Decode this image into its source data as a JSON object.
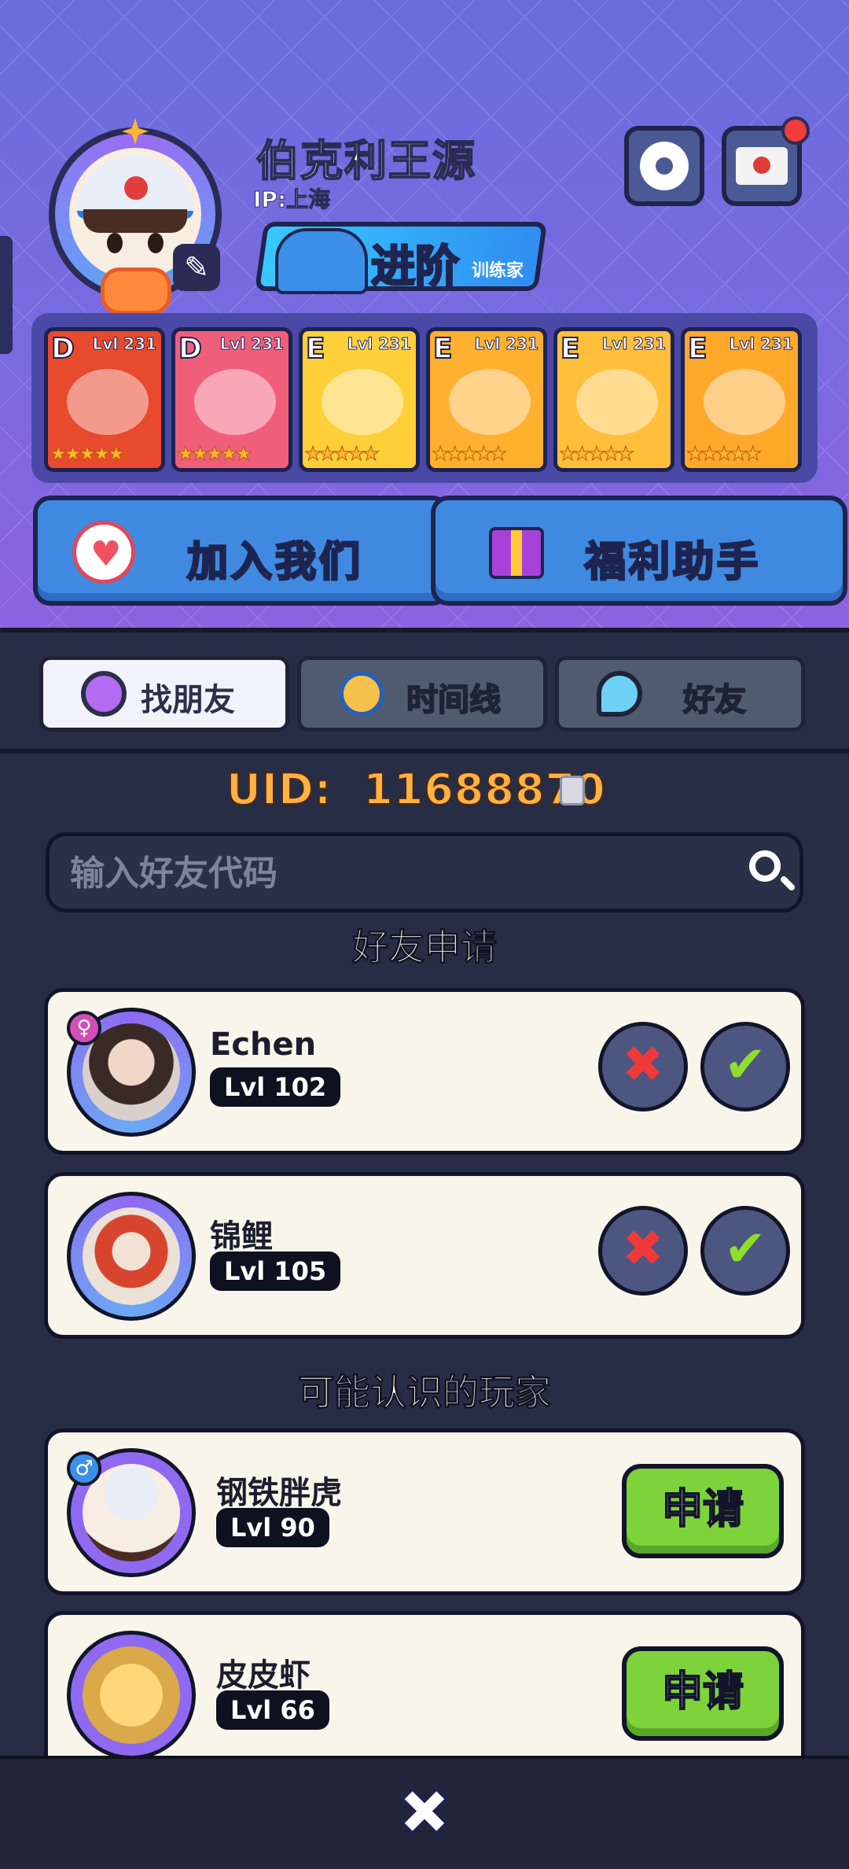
{
  "profile": {
    "name": "伯克利王源",
    "ip": "IP:上海",
    "promote_label": "进阶",
    "promote_sub": "训练家"
  },
  "top_buttons": {
    "settings_icon": "gear-icon",
    "mail_icon": "mail-icon"
  },
  "cards": [
    {
      "grade": "D",
      "level": "Lvl 231",
      "stars": "★★★★★",
      "color": "#e84a2e"
    },
    {
      "grade": "D",
      "level": "Lvl 231",
      "stars": "★★★★★",
      "color": "#f05f7a"
    },
    {
      "grade": "E",
      "level": "Lvl 231",
      "stars": "★★★★★",
      "color": "#ffcf3a"
    },
    {
      "grade": "E",
      "level": "Lvl 231",
      "stars": "★★★★★",
      "color": "#ffb02e"
    },
    {
      "grade": "E",
      "level": "Lvl 231",
      "stars": "★★★★★",
      "color": "#ffbf3a"
    },
    {
      "grade": "E",
      "level": "Lvl 231",
      "stars": "★★★★★",
      "color": "#ffa82a"
    }
  ],
  "actions": {
    "join_label": "加入我们",
    "welfare_label": "福利助手"
  },
  "tabs": [
    {
      "label": "找朋友",
      "icon": "search-icon",
      "active": true
    },
    {
      "label": "时间线",
      "icon": "clock-icon",
      "active": false
    },
    {
      "label": "好友",
      "icon": "friends-icon",
      "active": false
    }
  ],
  "uid": {
    "label": "UID:",
    "value": "11688870"
  },
  "search": {
    "placeholder": "输入好友代码",
    "value": ""
  },
  "requests": {
    "title": "好友申请",
    "items": [
      {
        "name": "Echen",
        "level": "Lvl 102",
        "gender": "♀"
      },
      {
        "name": "锦鲤",
        "level": "Lvl 105",
        "gender": ""
      }
    ]
  },
  "suggestions": {
    "title": "可能认识的玩家",
    "items": [
      {
        "name": "钢铁胖虎",
        "level": "Lvl 90",
        "gender": "♂",
        "button": "申请"
      },
      {
        "name": "皮皮虾",
        "level": "Lvl 66",
        "gender": "",
        "button": "申请"
      }
    ]
  },
  "footer": {
    "close_icon": "close-icon",
    "close_glyph": "✖"
  },
  "colors": {
    "header": "#7a6ae0",
    "accent_uid": "#ffb143",
    "apply_green": "#7ed23a",
    "reject_red": "#f03a3a"
  }
}
